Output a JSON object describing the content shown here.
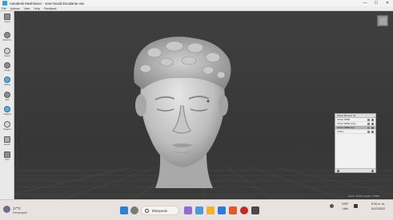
{
  "window": {
    "title": "Autodesk Meshmixer - Jose David Escalante.mix",
    "controls": [
      "—",
      "☐",
      "✕"
    ]
  },
  "menu": [
    "File",
    "Actions",
    "View",
    "Help",
    "Feedback"
  ],
  "toolbar": [
    {
      "label": "Import",
      "icon": "import-icon"
    },
    {
      "label": "Meshmix",
      "icon": "meshmix-icon"
    },
    {
      "label": "Select",
      "icon": "select-icon"
    },
    {
      "label": "Sculpt",
      "icon": "sculpt-icon"
    },
    {
      "label": "Stamp",
      "icon": "stamp-icon"
    },
    {
      "label": "Edit",
      "icon": "edit-icon"
    },
    {
      "label": "Analysis",
      "icon": "analysis-icon"
    },
    {
      "label": "Shaders",
      "icon": "shaders-icon"
    },
    {
      "label": "Export",
      "icon": "export-icon"
    },
    {
      "label": "Print",
      "icon": "print-icon"
    }
  ],
  "object_browser": {
    "title": "Object Browser (3)",
    "rows": [
      {
        "name": "STIGF OB/BS",
        "selected": false
      },
      {
        "name": "STIGF OB/BS (stub)",
        "selected": false
      },
      {
        "name": "STIGF OB/BS stub",
        "selected": true
      },
      {
        "name": "TFNGo",
        "selected": false
      }
    ]
  },
  "viewport": {
    "status": "vertices: 367482 triangles: 734960"
  },
  "taskbar": {
    "temperature": "17°C",
    "condition": "Despejado",
    "search_label": "Búsqueda",
    "language": "ESP",
    "language_sub": "LAA",
    "time": "9:32 a. m.",
    "date": "5/12/2022"
  }
}
